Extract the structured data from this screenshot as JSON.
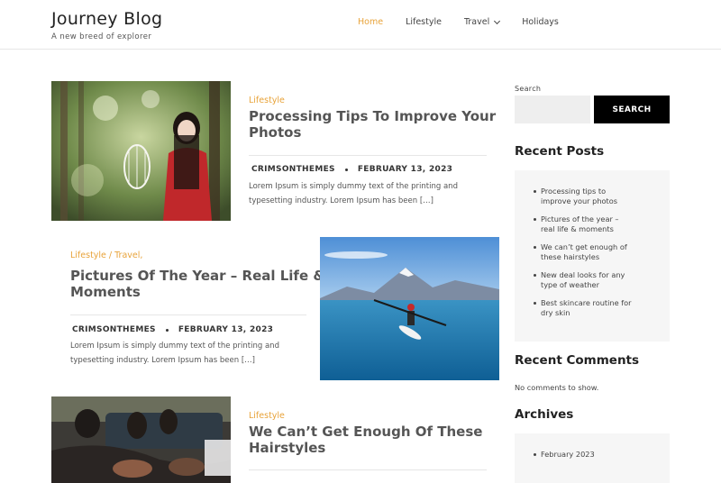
{
  "header": {
    "site_title": "Journey Blog",
    "tagline": "A new breed of explorer",
    "nav": [
      {
        "label": "Home",
        "active": true
      },
      {
        "label": "Lifestyle",
        "active": false
      },
      {
        "label": "Travel",
        "active": false,
        "has_dropdown": true
      },
      {
        "label": "Holidays",
        "active": false
      }
    ]
  },
  "posts": [
    {
      "category": "Lifestyle",
      "title_line1": "Processing Tips To Improve Your",
      "title_line2": "Photos",
      "author": "CRIMSONTHEMES",
      "date": "FEBRUARY 13, 2023",
      "excerpt_line1": "Lorem Ipsum is simply dummy text of the printing and",
      "excerpt_line2": "typesetting industry. Lorem Ipsum has been […]"
    },
    {
      "category": "Lifestyle / Travel,",
      "title_line1": "Pictures Of The Year – Real Life &",
      "title_line2": "Moments",
      "author": "CRIMSONTHEMES",
      "date": "FEBRUARY 13, 2023",
      "excerpt_line1": "Lorem Ipsum is simply dummy text of the printing and",
      "excerpt_line2": "typesetting industry. Lorem Ipsum has been […]"
    },
    {
      "category": "Lifestyle",
      "title_line1": "We Can’t Get Enough Of These",
      "title_line2": "Hairstyles"
    }
  ],
  "sidebar": {
    "search_label": "Search",
    "search_placeholder": "",
    "search_button": "SEARCH",
    "recent_posts_title": "Recent Posts",
    "recent_posts": [
      {
        "line1": "Processing tips to",
        "line2": "improve your photos"
      },
      {
        "line1": "Pictures of the year –",
        "line2": "real life & moments"
      },
      {
        "line1": "We can’t get enough of",
        "line2": "these hairstyles"
      },
      {
        "line1": "New deal looks for any",
        "line2": "type of weather"
      },
      {
        "line1": "Best skincare routine for",
        "line2": "dry skin"
      }
    ],
    "recent_comments_title": "Recent Comments",
    "no_comments": "No comments to show.",
    "archives_title": "Archives",
    "archives": [
      "February 2023"
    ]
  },
  "colors": {
    "accent": "#e8a33a",
    "search_button_bg": "#000000",
    "widget_bg": "#f6f6f6"
  }
}
